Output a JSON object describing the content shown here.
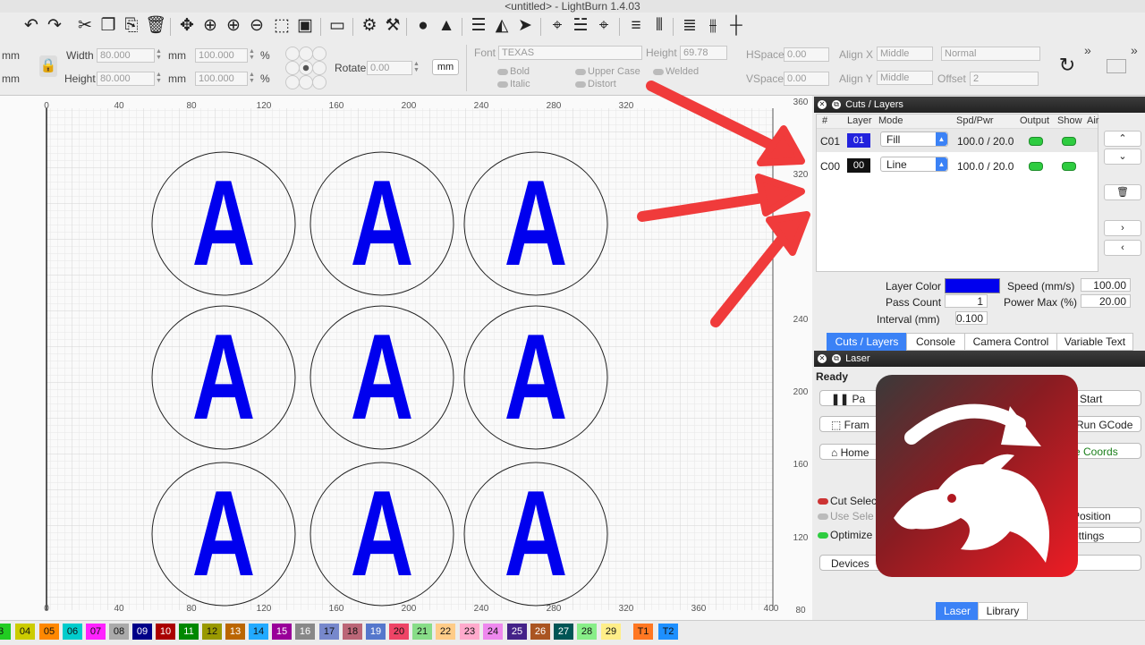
{
  "window": {
    "title": "<untitled> - LightBurn 1.4.03"
  },
  "toolbar": {
    "icons": [
      "undo-icon",
      "redo-icon",
      "cut-icon",
      "copy-icon",
      "paste-icon",
      "delete-icon",
      "move-icon",
      "zoom-in-icon",
      "zoom-in-2-icon",
      "zoom-out-icon",
      "frame-select-icon",
      "camera-icon",
      "monitor-icon",
      "settings-icon",
      "tools-icon",
      "users-icon",
      "user-icon",
      "align-icon",
      "mirror-icon",
      "send-icon",
      "target-icon",
      "laser-icon",
      "align-h-icon",
      "distribute-icon",
      "align-c-icon",
      "align-d-icon",
      "crosshair-icon"
    ]
  },
  "propbar": {
    "width_label": "Width",
    "width_value": "80.000",
    "height_label": "Height",
    "height_value": "80.000",
    "unit_mm": "mm",
    "pct_value1": "100.000",
    "pct_value2": "100.000",
    "pct_unit": "%",
    "rotate_label": "Rotate",
    "rotate_value": "0.00",
    "mm_button": "mm",
    "font_label": "Font",
    "font_value": "TEXAS",
    "height2_label": "Height",
    "height2_value": "69.78",
    "hspace_label": "HSpace",
    "hspace_value": "0.00",
    "vspace_label": "VSpace",
    "vspace_value": "0.00",
    "alignx_label": "Align X",
    "alignx_value": "Middle",
    "aligny_label": "Align Y",
    "aligny_value": "Middle",
    "normal_value": "Normal",
    "offset_label": "Offset",
    "offset_value": "2",
    "bold": "Bold",
    "italic": "Italic",
    "uppercase": "Upper Case",
    "distort": "Distort",
    "welded": "Welded",
    "more": "»"
  },
  "canvas": {
    "letter": "A",
    "top_ruler": [
      "0",
      "40",
      "80",
      "120",
      "160",
      "200",
      "240",
      "280",
      "320"
    ],
    "bottom_ruler": [
      "0",
      "40",
      "80",
      "120",
      "160",
      "200",
      "240",
      "280",
      "320",
      "360",
      "400"
    ],
    "right_ruler": [
      "360",
      "320",
      "240",
      "200",
      "160",
      "120",
      "80"
    ]
  },
  "cuts": {
    "panel_title": "Cuts / Layers",
    "headers": {
      "num": "#",
      "layer": "Layer",
      "mode": "Mode",
      "spd": "Spd/Pwr",
      "output": "Output",
      "show": "Show",
      "air": "Air"
    },
    "rows": [
      {
        "id": "C01",
        "layer": "01",
        "color": "#2222dd",
        "mode": "Fill",
        "spd": "100.0 / 20.0"
      },
      {
        "id": "C00",
        "layer": "00",
        "color": "#111111",
        "mode": "Line",
        "spd": "100.0 / 20.0"
      }
    ],
    "layer_color_label": "Layer Color",
    "layer_color": "#0000ee",
    "speed_label": "Speed (mm/s)",
    "speed_value": "100.00",
    "pass_label": "Pass Count",
    "pass_value": "1",
    "power_label": "Power Max (%)",
    "power_value": "20.00",
    "interval_label": "Interval (mm)",
    "interval_value": "0.100",
    "tabs": [
      "Cuts / Layers",
      "Console",
      "Camera Control",
      "Variable Text"
    ]
  },
  "laser": {
    "panel_title": "Laser",
    "status": "Ready",
    "pause": "Pa",
    "start": "Start",
    "frame": "Fram",
    "run_gcode": "Run GCode",
    "home": "Home",
    "coords": "e Coords",
    "cut_selected": "Cut Selec",
    "use_selection": "Use Sele",
    "optimize": "Optimize",
    "position": "Position",
    "settings": "ettings",
    "devices": "Devices",
    "tabs": [
      "Laser",
      "Library"
    ]
  },
  "palette": [
    {
      "label": "3",
      "color": "#22cc22"
    },
    {
      "label": "04",
      "color": "#cccc00"
    },
    {
      "label": "05",
      "color": "#ff8800"
    },
    {
      "label": "06",
      "color": "#00cccc"
    },
    {
      "label": "07",
      "color": "#ff22ff"
    },
    {
      "label": "08",
      "color": "#aaaaaa"
    },
    {
      "label": "09",
      "color": "#000088"
    },
    {
      "label": "10",
      "color": "#aa0000"
    },
    {
      "label": "11",
      "color": "#008800"
    },
    {
      "label": "12",
      "color": "#999900"
    },
    {
      "label": "13",
      "color": "#bb6600"
    },
    {
      "label": "14",
      "color": "#22aaff"
    },
    {
      "label": "15",
      "color": "#990099"
    },
    {
      "label": "16",
      "color": "#888888"
    },
    {
      "label": "17",
      "color": "#7788cc"
    },
    {
      "label": "18",
      "color": "#bb6677"
    },
    {
      "label": "19",
      "color": "#5577cc"
    },
    {
      "label": "20",
      "color": "#ee4466"
    },
    {
      "label": "21",
      "color": "#88dd88"
    },
    {
      "label": "22",
      "color": "#ffcc88"
    },
    {
      "label": "23",
      "color": "#ffaacc"
    },
    {
      "label": "24",
      "color": "#ee88ee"
    },
    {
      "label": "25",
      "color": "#442288"
    },
    {
      "label": "26",
      "color": "#aa5522"
    },
    {
      "label": "27",
      "color": "#005555"
    },
    {
      "label": "28",
      "color": "#88ee88"
    },
    {
      "label": "29",
      "color": "#ffee88"
    },
    {
      "label": "T1",
      "color": "#ff7722"
    },
    {
      "label": "T2",
      "color": "#1e90ff"
    }
  ],
  "colors": {
    "accent": "#3b82f6",
    "arrow": "#f03b3b",
    "letter": "#0000ee"
  }
}
